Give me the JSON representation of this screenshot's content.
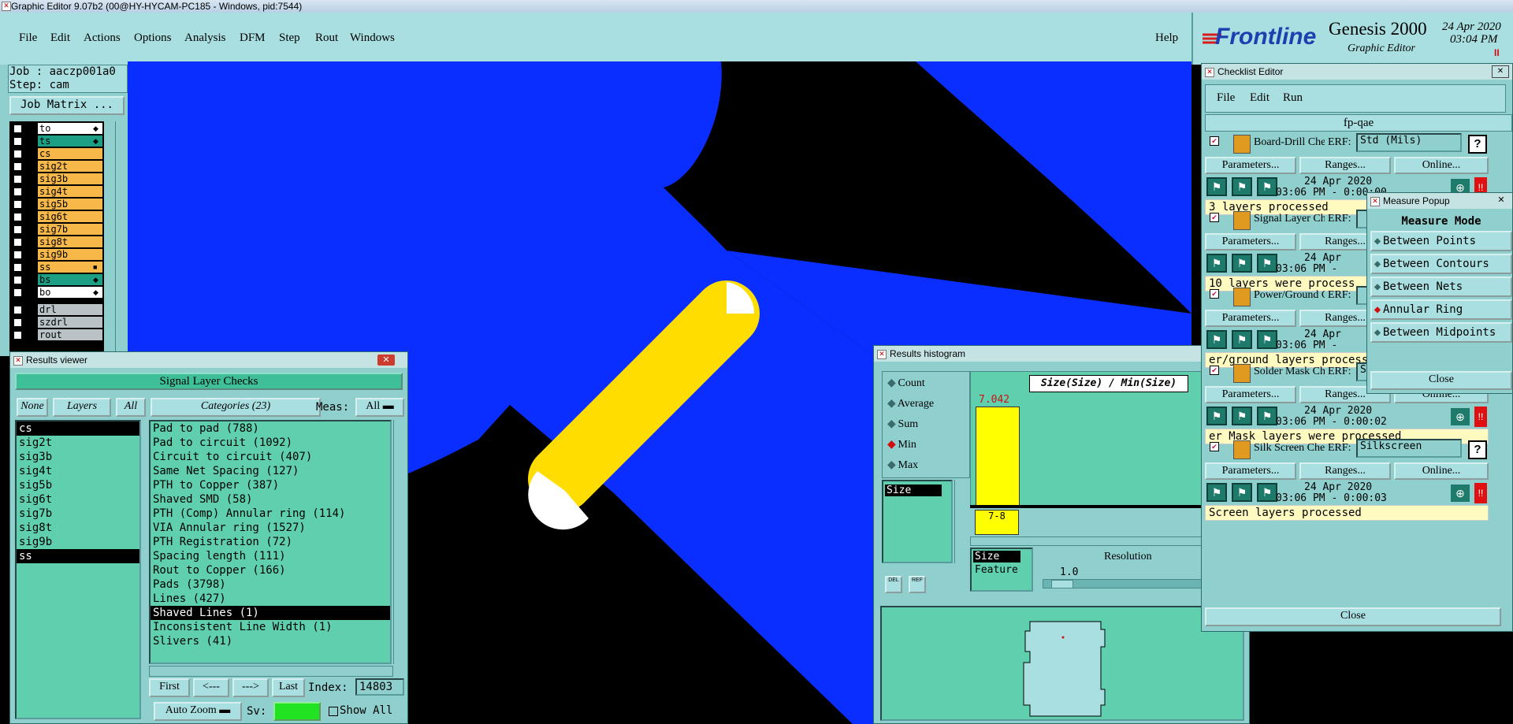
{
  "os_title": "Graphic Editor 9.07b2 (00@HY-HYCAM-PC185 - Windows, pid:7544)",
  "menu": [
    "File",
    "Edit",
    "Actions",
    "Options",
    "Analysis",
    "DFM",
    "Step",
    "Rout",
    "Windows"
  ],
  "help": "Help",
  "logo": {
    "brand": "Frontline",
    "product": "Genesis 2000",
    "subtitle": "Graphic Editor",
    "date": "24 Apr 2020",
    "time": "03:04 PM"
  },
  "job": {
    "job_line": "Job : aaczp001a0",
    "step_line": "Step: cam",
    "matrix_btn": "Job Matrix ..."
  },
  "layers": [
    {
      "name": "to",
      "color": "#ffffff",
      "mark": "◆"
    },
    {
      "name": "ts",
      "color": "#1d9f86",
      "mark": "◆"
    },
    {
      "name": "cs",
      "color": "#f7b84a",
      "mark": ""
    },
    {
      "name": "sig2t",
      "color": "#f7b84a",
      "mark": ""
    },
    {
      "name": "sig3b",
      "color": "#f7b84a",
      "mark": ""
    },
    {
      "name": "sig4t",
      "color": "#f7b84a",
      "mark": ""
    },
    {
      "name": "sig5b",
      "color": "#f7b84a",
      "mark": ""
    },
    {
      "name": "sig6t",
      "color": "#f7b84a",
      "mark": ""
    },
    {
      "name": "sig7b",
      "color": "#f7b84a",
      "mark": ""
    },
    {
      "name": "sig8t",
      "color": "#f7b84a",
      "mark": ""
    },
    {
      "name": "sig9b",
      "color": "#f7b84a",
      "mark": ""
    },
    {
      "name": "ss",
      "color": "#f7b84a",
      "mark": "■"
    },
    {
      "name": "bs",
      "color": "#1d9f86",
      "mark": "◆"
    },
    {
      "name": "bo",
      "color": "#ffffff",
      "mark": "◆"
    },
    {
      "name": "drl",
      "color": "#b9c3c6",
      "mark": ""
    },
    {
      "name": "szdrl",
      "color": "#b9c3c6",
      "mark": ""
    },
    {
      "name": "rout",
      "color": "#b9c3c6",
      "mark": ""
    }
  ],
  "results_viewer": {
    "title": "Results viewer",
    "header": "Signal Layer Checks",
    "btn_none": "None",
    "btn_layers": "Layers",
    "btn_all": "All",
    "categories_btn": "Categories (23)",
    "meas_label": "Meas:",
    "meas_value": "All",
    "layer_list": [
      "cs",
      "sig2t",
      "sig3b",
      "sig4t",
      "sig5b",
      "sig6t",
      "sig7b",
      "sig8t",
      "sig9b",
      "ss"
    ],
    "categories": [
      "Pad to pad (788)",
      "Pad to circuit (1092)",
      "Circuit to circuit (407)",
      "Same Net Spacing (127)",
      "PTH to Copper (387)",
      "Shaved SMD (58)",
      "PTH (Comp) Annular ring (114)",
      "VIA Annular ring (1527)",
      "PTH Registration (72)",
      "Spacing length (111)",
      "Rout to Copper (166)",
      "Pads (3798)",
      "Lines (427)",
      "Shaved Lines (1)",
      "Inconsistent Line Width (1)",
      "Slivers (41)"
    ],
    "nav": {
      "first": "First",
      "prev": "<---",
      "next": "--->",
      "last": "Last",
      "index_label": "Index:",
      "index_value": "14803"
    },
    "auto_zoom": "Auto Zoom",
    "sv_label": "Sv:",
    "show_all": "Show All"
  },
  "histogram": {
    "title": "Results histogram",
    "modes": [
      "Count",
      "Average",
      "Sum",
      "Min",
      "Max"
    ],
    "selected_mode": "Min",
    "chart_title": "Size(Size) / Min(Size)",
    "bar_value": "7.042",
    "bar_label": "7-8",
    "list_item": "Size",
    "attrs": [
      "Size",
      "Feature"
    ],
    "resolution_label": "Resolution",
    "resolution_value": "1.0",
    "del_btn": "DEL",
    "ref_btn": "REF"
  },
  "checklist": {
    "title": "Checklist Editor",
    "menu": [
      "File",
      "Edit",
      "Run"
    ],
    "name": "fp-qae",
    "params_btn": "Parameters...",
    "ranges_btn": "Ranges...",
    "online_btn": "Online...",
    "erf_label": "ERF:",
    "checks": [
      {
        "name": "Board-Drill Che",
        "erf": "Std (Mils)",
        "date": "24 Apr 2020",
        "time": "03:06 PM - 0:00:00",
        "status": "3 layers processed"
      },
      {
        "name": "Signal Layer Ch",
        "erf": "",
        "date": "24 Apr",
        "time": "03:06 PM -",
        "status": "10 layers were process"
      },
      {
        "name": "Power/Ground C",
        "erf": "",
        "date": "24 Apr",
        "time": "03:06 PM -",
        "status": "er/ground layers processed"
      },
      {
        "name": "Solder Mask Ch",
        "erf": "Soldermask",
        "date": "24 Apr 2020",
        "time": "03:06 PM - 0:00:02",
        "status": "er Mask layers were processed"
      },
      {
        "name": "Silk Screen Che",
        "erf": "Silkscreen",
        "date": "24 Apr 2020",
        "time": "03:06 PM - 0:00:03",
        "status": " Screen layers processed"
      }
    ],
    "close": "Close"
  },
  "measure": {
    "title": "Measure Popup",
    "header": "Measure Mode",
    "options": [
      "Between Points",
      "Between Contours",
      "Between Nets",
      "Annular Ring",
      "Between Midpoints"
    ],
    "selected": "Annular Ring",
    "close": "Close"
  }
}
